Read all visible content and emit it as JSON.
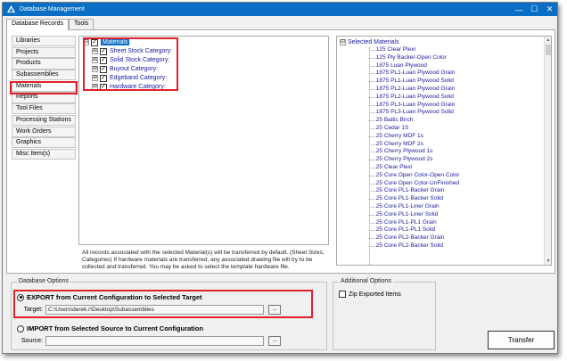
{
  "window": {
    "title": "Database Management",
    "controls": {
      "minimize": "—",
      "maximize": "☐",
      "close": "✕"
    }
  },
  "tabs": [
    {
      "label": "Database Records",
      "active": true
    },
    {
      "label": "Tools",
      "active": false
    }
  ],
  "nav": {
    "items": [
      {
        "label": "Libraries"
      },
      {
        "label": "Projects"
      },
      {
        "label": "Products"
      },
      {
        "label": "Subassemblies"
      },
      {
        "label": "Materials"
      },
      {
        "label": "Reports"
      },
      {
        "label": "Tool Files"
      },
      {
        "label": "Processing Stations"
      },
      {
        "label": "Work Orders"
      },
      {
        "label": "Graphics"
      },
      {
        "label": "Misc Item(s)"
      }
    ],
    "selected": "Materials"
  },
  "tree": {
    "root": {
      "label": "Materials",
      "expander": "⊟",
      "checked": true
    },
    "children": [
      {
        "label": "Sheet Stock Category:",
        "expander": "⊞",
        "checked": true
      },
      {
        "label": "Solid Stock Category:",
        "expander": "⊞",
        "checked": true
      },
      {
        "label": "Buyout Category:",
        "expander": "⊞",
        "checked": true
      },
      {
        "label": "Edgeband Category:",
        "expander": "⊞",
        "checked": true
      },
      {
        "label": "Hardware Category:",
        "expander": "⊞",
        "checked": true
      }
    ]
  },
  "notice": "All records associated with the selected Material(s) will be transferred by default.  (Sheet Sizes, Categories) If hardware materials are transferred, any associated drawing file will try to be collected and transferred.  You may be asked to select the template hardware file.",
  "selected_materials": {
    "header": "Selected Materials",
    "expander": "⊟",
    "items": [
      ".125 Clear Plexi",
      ".125 Ply Backer-Open Color",
      ".1875 Luan Plywood",
      ".1875 PL1-Luan Plywood Grain",
      ".1875 PL1-Luan Plywood Solid",
      ".1875 PL2-Luan Plywood Grain",
      ".1875 PL2-Luan Plywood Solid",
      ".1875 PL3-Luan Plywood Grain",
      ".1875 PL3-Luan Plywood Solid",
      ".25 Baltic Birch",
      ".25 Cedar 1S",
      ".25 Cherry MDF 1s",
      ".25 Cherry MDF 2s",
      ".25 Cherry Plywood 1s",
      ".25 Cherry Plywood 2s",
      ".25 Clear Plexi",
      ".25 Core Open Color-Open Color",
      ".25 Core Open Color-UnFinished",
      ".25 Core PL1-Backer Grain",
      ".25 Core PL1-Backer Solid",
      ".25 Core PL1-Liner Grain",
      ".25 Core PL1-Liner Solid",
      ".25 Core PL1-PL1 Grain",
      ".25 Core PL1-PL1 Solid",
      ".25 Core PL2-Backer Grain",
      ".25 Core PL2-Backer Solid"
    ],
    "scroll": {
      "up": "▲",
      "down": "▼"
    }
  },
  "database_options": {
    "title": "Database Options",
    "export": {
      "label": "EXPORT from Current Configuration to Selected Target",
      "checked": true
    },
    "target": {
      "label": "Target:",
      "value": "C:\\Users\\derek.r\\Desktop\\Subassemblies",
      "browse": "..."
    },
    "import": {
      "label": "IMPORT from Selected Source to Current Configuration",
      "checked": false
    },
    "source": {
      "label": "Source:",
      "value": "",
      "browse": "..."
    }
  },
  "additional_options": {
    "title": "Additional Options",
    "zip": {
      "label": "Zip Exported Items",
      "checked": false
    }
  },
  "transfer_button": "Transfer",
  "colors": {
    "titlebar": "#0a6fc4",
    "highlight": "#e0202a",
    "tree_text": "#1a1aa0"
  }
}
